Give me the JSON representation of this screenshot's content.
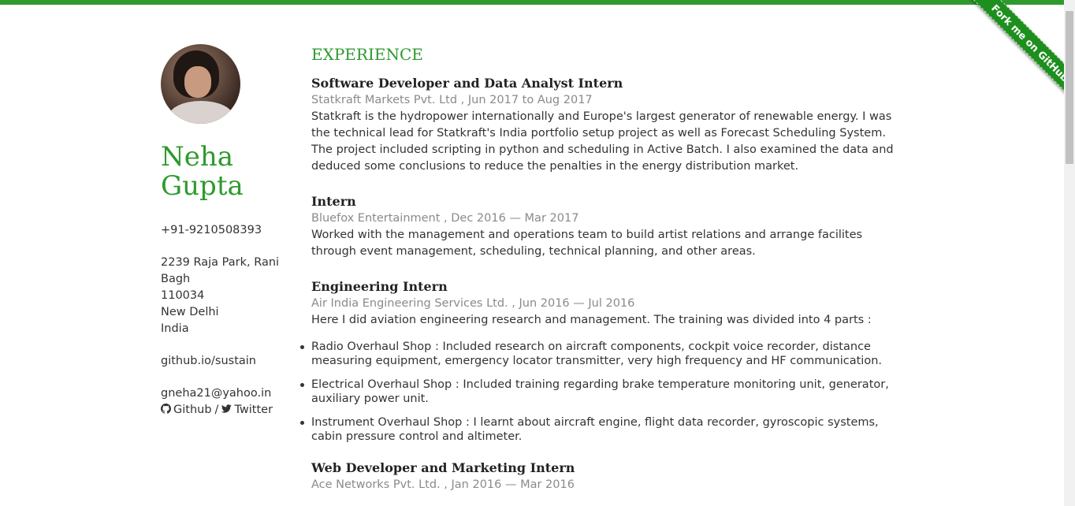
{
  "ribbon": {
    "label": "Fork me on GitHub"
  },
  "profile": {
    "first_name": "Neha",
    "last_name": "Gupta",
    "phone": "+91-9210508393",
    "address_lines": [
      "2239 Raja Park, Rani Bagh",
      "110034",
      "New Delhi",
      "India"
    ],
    "website": "github.io/sustain",
    "email": "gneha21@yahoo.in",
    "social": {
      "github": "Github",
      "separator": "/",
      "twitter": "Twitter"
    }
  },
  "experience": {
    "title": "EXPERIENCE",
    "jobs": [
      {
        "title": "Software Developer and Data Analyst Intern",
        "meta": "Statkraft Markets Pvt. Ltd , Jun 2017 to Aug 2017",
        "description": "Statkraft is the hydropower internationally and Europe's largest generator of renewable energy. I was the technical lead for Statkraft's India portfolio setup project as well as Forecast Scheduling System. The project included scripting in python and scheduling in Active Batch. I also examined the data and deduced some conclusions to reduce the penalties in the energy distribution market."
      },
      {
        "title": "Intern",
        "meta": "Bluefox Entertainment , Dec 2016 — Mar 2017",
        "description": "Worked with the management and operations team to build artist relations and arrange facilites through event management, scheduling, technical planning, and other areas."
      },
      {
        "title": "Engineering Intern",
        "meta": "Air India Engineering Services Ltd. , Jun 2016 — Jul 2016",
        "description": "Here I did aviation engineering research and management. The training was divided into 4 parts :",
        "items": [
          "Radio Overhaul Shop : Included research on aircraft components, cockpit voice recorder, distance measuring equipment, emergency locator transmitter, very high frequency and HF communication.",
          "Electrical Overhaul Shop : Included training regarding brake temperature monitoring unit, generator, auxiliary power unit.",
          "Instrument Overhaul Shop : I learnt about aircraft engine, flight data recorder, gyroscopic systems, cabin pressure control and altimeter."
        ]
      },
      {
        "title": "Web Developer and Marketing Intern",
        "meta": "Ace Networks Pvt. Ltd. , Jan 2016 — Mar 2016"
      }
    ]
  },
  "colors": {
    "accent": "#2e9a2e",
    "ribbon": "#1d8f1d",
    "meta": "#8a8a8a",
    "text": "#333333"
  }
}
